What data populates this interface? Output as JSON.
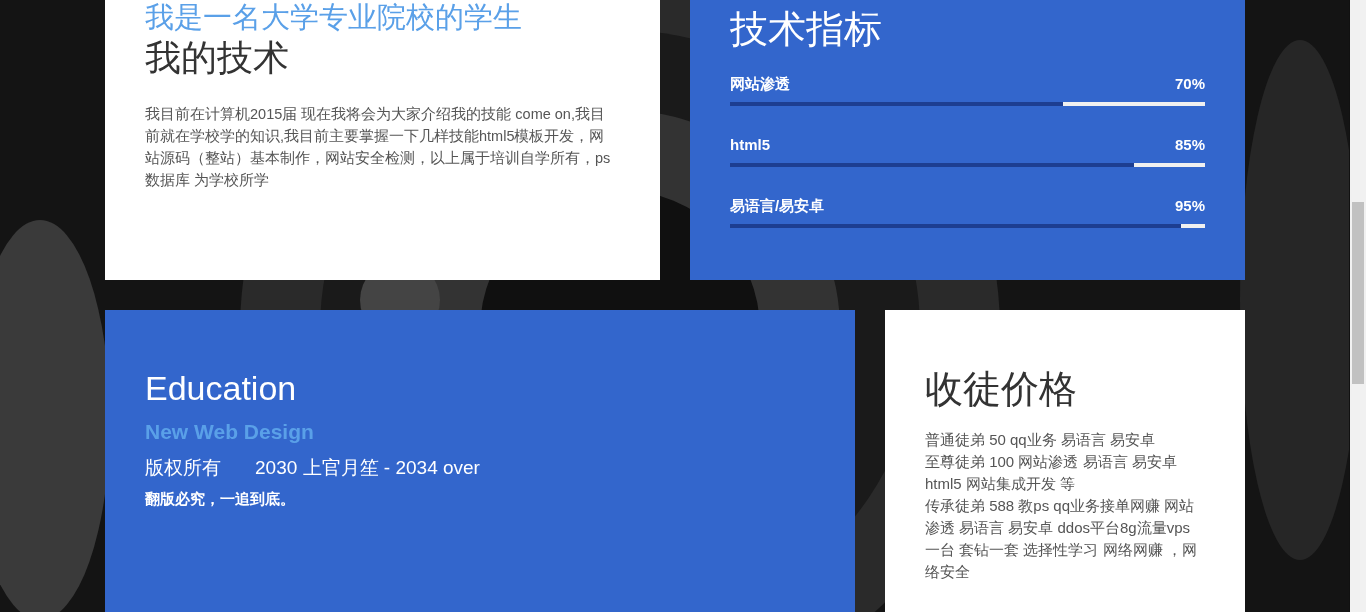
{
  "about": {
    "subtitle": "我是一名大学专业院校的学生",
    "title": "我的技术",
    "text": "我目前在计算机2015届 现在我将会为大家介绍我的技能 come on,我目前就在学校学的知识,我目前主要掌握一下几样技能html5模板开发，网站源码（整站）基本制作，网站安全检测，以上属于培训自学所有，ps 数据库 为学校所学"
  },
  "skills": {
    "title": "技术指标",
    "items": [
      {
        "name": "网站渗透",
        "reading": "70%",
        "level": 0.7
      },
      {
        "name": "html5",
        "reading": "85%",
        "level": 0.85
      },
      {
        "name": "易语言/易安卓",
        "reading": "95%",
        "level": 0.95
      }
    ]
  },
  "education": {
    "title": "Education",
    "subtitle": "New Web Design",
    "line_left": "版权所有",
    "line_right": "2030 上官月笙 - 2034 over",
    "note": "翻版必究，一追到底。"
  },
  "pricing": {
    "title": "收徒价格",
    "items": [
      "普通徒弟 50 qq业务 易语言 易安卓",
      "至尊徒弟 100 网站渗透 易语言 易安卓 html5 网站集成开发 等",
      "传承徒弟 588 教ps qq业务接单网赚 网站渗透 易语言 易安卓 ddos平台8g流量vps一台 套钻一套 选择性学习 网络网赚 ，网络安全"
    ]
  }
}
